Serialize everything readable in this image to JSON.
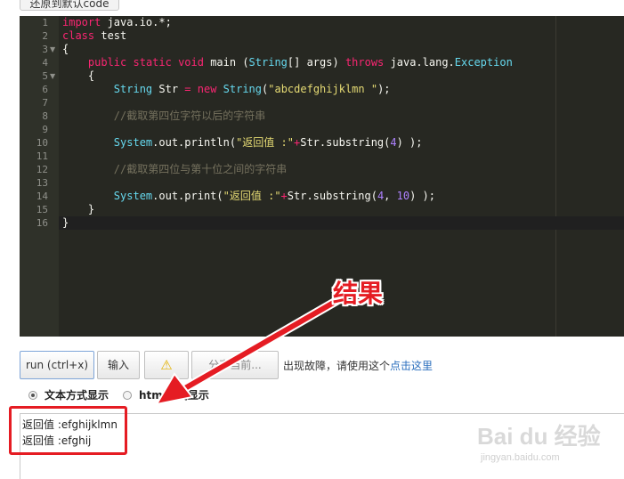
{
  "top_button": {
    "label": "还原到默认code"
  },
  "editor": {
    "lines": [
      {
        "n": "1"
      },
      {
        "n": "2"
      },
      {
        "n": "3"
      },
      {
        "n": "4"
      },
      {
        "n": "5"
      },
      {
        "n": "6"
      },
      {
        "n": "7"
      },
      {
        "n": "8"
      },
      {
        "n": "9"
      },
      {
        "n": "10"
      },
      {
        "n": "11"
      },
      {
        "n": "12"
      },
      {
        "n": "13"
      },
      {
        "n": "14"
      },
      {
        "n": "15"
      },
      {
        "n": "16"
      }
    ],
    "code": {
      "l1_kw": "import",
      "l1_rest": " java.io.*;",
      "l2_kw": "class",
      "l2_rest": " test",
      "l3": "{",
      "l4_indent": "    ",
      "l4_kw1": "public",
      "l4_kw2": " static",
      "l4_kw3": " void",
      "l4_main": " main (",
      "l4_type": "String",
      "l4_args": "[] args) ",
      "l4_throws": "throws",
      "l4_pkg": " java.lang.",
      "l4_exc": "Exception",
      "l5": "    {",
      "l6_indent": "        ",
      "l6_type": "String",
      "l6_var": " Str ",
      "l6_eq": "=",
      "l6_new": " new",
      "l6_space": " ",
      "l6_type2": "String",
      "l6_paren": "(",
      "l6_str": "\"abcdefghijklmn \"",
      "l6_end": ");",
      "l8_indent": "        ",
      "l8_comment": "//截取第四位字符以后的字符串",
      "l10_indent": "        ",
      "l10_sys": "System",
      "l10_mid": ".out.println(",
      "l10_str": "\"返回值 :\"",
      "l10_plus": "+",
      "l10_call": "Str.substring(",
      "l10_num": "4",
      "l10_end": ") );",
      "l12_indent": "        ",
      "l12_comment": "//截取第四位与第十位之间的字符串",
      "l14_indent": "        ",
      "l14_sys": "System",
      "l14_mid": ".out.print(",
      "l14_str": "\"返回值 :\"",
      "l14_plus": "+",
      "l14_call": "Str.substring(",
      "l14_num1": "4",
      "l14_comma": ", ",
      "l14_num2": "10",
      "l14_end": ") );",
      "l15": "    }",
      "l16": "}"
    }
  },
  "toolbar": {
    "run_label": "run (ctrl+x)",
    "input_label": "输入",
    "warn_icon": "⚠",
    "share_label": "分享当前...",
    "fault_text": "出现故障，请使用这个",
    "fault_link": "点击这里"
  },
  "display_mode": {
    "text_label": "文本方式显示",
    "html_label": "html方式显示",
    "selected": "text"
  },
  "output": {
    "line1": "返回值 :efghijklmn",
    "line2": "返回值 :efghij"
  },
  "annotation": {
    "label": "结果",
    "color": "#e51c23"
  },
  "watermark": {
    "main": "Bai du 经验",
    "sub": "jingyan.baidu.com"
  },
  "colors": {
    "editor_bg": "#272822",
    "keyword": "#f92672",
    "type": "#66d9ef",
    "string": "#e6db74",
    "number": "#ae81ff",
    "comment": "#75715e",
    "link": "#2a6ebd"
  }
}
